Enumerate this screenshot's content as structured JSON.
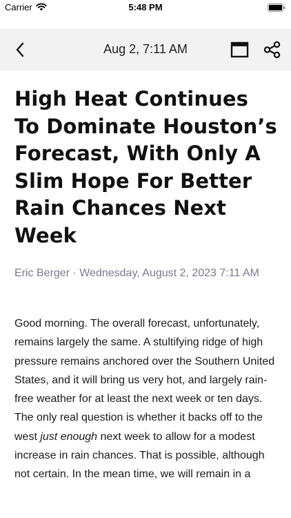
{
  "status_bar": {
    "carrier": "Carrier",
    "time": "5:48 PM",
    "icons": [
      "wifi-icon",
      "battery-icon"
    ]
  },
  "nav": {
    "title": "Aug 2, 7:11 AM",
    "icons": [
      "chevron-left-icon",
      "browser-window-icon",
      "share-icon"
    ]
  },
  "article": {
    "headline": "High Heat Continues To Dominate Houston’s Forecast, With Only A Slim Hope For Better Rain Chances Next Week",
    "byline": "Eric Berger · Wednesday, August 2, 2023 7:11 AM",
    "body_before_emphasis": "Good morning. The overall forecast, unfortunately, remains largely the same. A stultifying ridge of high pressure remains anchored over the Southern United States, and it will bring us very hot, and largely rain-free weather for at least the next week or ten days. The only real question is whether it backs off to the west ",
    "body_emphasis": "just enough",
    "body_after_emphasis": " next week to allow for a modest increase in rain chances. That is possible, although not certain. In the mean time, we will remain in a"
  },
  "colors": {
    "nav_background": "#f2f2f2",
    "byline": "#7b7891",
    "text": "#111111"
  }
}
